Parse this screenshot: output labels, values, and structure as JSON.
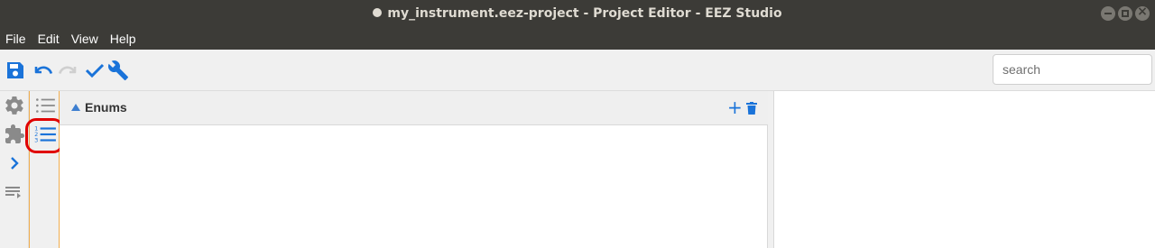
{
  "window": {
    "title": "my_instrument.eez-project - Project Editor - EEZ Studio"
  },
  "menu": {
    "items": [
      "File",
      "Edit",
      "View",
      "Help"
    ]
  },
  "toolbar": {
    "buttons": [
      "save-icon",
      "undo-icon",
      "redo-icon",
      "check-icon",
      "wrench-icon"
    ],
    "search": {
      "placeholder": "search",
      "value": ""
    }
  },
  "sidebar": {
    "icons": [
      "gear-icon",
      "puzzle-icon",
      "chevron-right-icon",
      "list-arrow-icon"
    ]
  },
  "subnav": {
    "icons": [
      "bullet-list-icon",
      "numbered-list-icon"
    ],
    "selected": "numbered-list-icon"
  },
  "panel": {
    "title": "Enums",
    "actions": [
      "add-icon",
      "delete-icon"
    ],
    "items": []
  },
  "colors": {
    "accent": "#1a73d9",
    "titlebar": "#3c3b37",
    "highlight": "#e00000",
    "subbar_border": "#f0ad4e"
  }
}
